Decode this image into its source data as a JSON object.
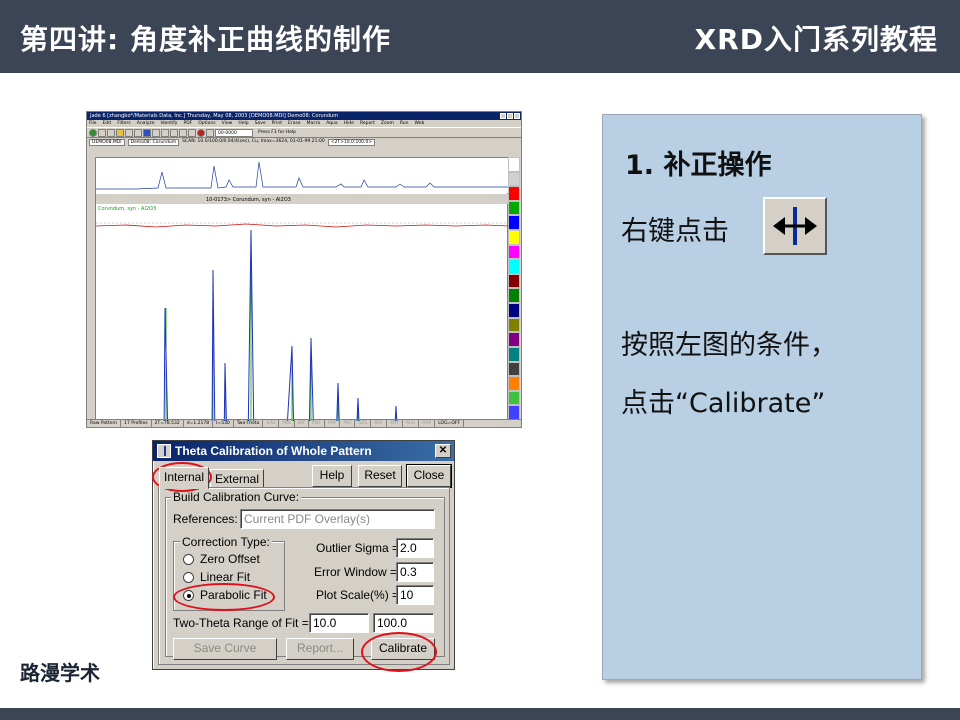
{
  "header": {
    "lecture_title": "第四讲: 角度补正曲线的制作",
    "series_title": "XRD入门系列教程"
  },
  "brand": "路漫学术",
  "jade_window": {
    "title": "Jade 6 [zhangbo*/Materials Data, Inc.] Thursday, May 08, 2003 [DEMO08.MDI] Demo08: Corundum",
    "menu": [
      "File",
      "Edit",
      "Filters",
      "Analyze",
      "Identify",
      "PDF",
      "Options",
      "View",
      "Help",
      "Save",
      "Print",
      "Erase",
      "Macro",
      "Aqua",
      "Hide",
      "Report",
      "Zoom",
      "Run",
      "Web"
    ],
    "combo_value": "00-0000",
    "help_hint": "Press F1 for Help",
    "file_combo": "DEMO08.MDI",
    "sample_name": "Demo08: Corundum",
    "scan_info": "SCAN: 10.0/100.0/0.04/4(sec), Cu, Imax=3624, 01-01-99 21:00",
    "range_info": "<2T>10.0:100.0>",
    "pdf_overlay": "10-0173> Corundum, syn - Al2O3",
    "legend_text": "Corundum, syn - Al2O3",
    "y_label_top": "Counts",
    "y_label_main": "Intensity(Counts)",
    "x_ticks": [
      "10",
      "20",
      "30",
      "40",
      "50",
      "60",
      "70",
      "80",
      "90",
      "100"
    ],
    "status": [
      "Raw Pattern",
      "17 Profiles",
      "2T=78.532",
      "d=1.2178",
      "I=530",
      "Two-Theta",
      "SAV",
      "PKS",
      "DIF",
      "PDF",
      "PRF",
      "PKT",
      "SZS",
      "XRF",
      "XRT",
      "ACH",
      "RRP",
      "LOG=OFF"
    ]
  },
  "dialog": {
    "title": "Theta Calibration of Whole Pattern",
    "tab_internal": "Internal",
    "tab_external": "External",
    "help_button": "Help",
    "reset_button": "Reset",
    "close_button": "Close",
    "build_group": "Build Calibration Curve:",
    "references_label": "References:",
    "references_value": "Current PDF Overlay(s)",
    "correction_group": "Correction Type:",
    "radio_zero": "Zero Offset",
    "radio_linear": "Linear Fit",
    "radio_parabolic": "Parabolic Fit",
    "outlier_label": "Outlier Sigma =",
    "outlier_value": "2.0",
    "error_label": "Error Window =",
    "error_value": "0.3",
    "plot_label": "Plot Scale(%) =",
    "plot_value": "10",
    "range_label": "Two-Theta Range of Fit =",
    "range_min": "10.0",
    "range_max": "100.0",
    "save_button": "Save Curve",
    "report_button": "Report...",
    "calibrate_button": "Calibrate"
  },
  "panel": {
    "heading": "1. 补正操作",
    "step1": "右键点击",
    "step2": "按照左图的条件，",
    "step3": "点击“Calibrate”"
  },
  "colors": {
    "header_bg": "#3c4555",
    "panel_bg": "#b8cfe4",
    "highlight": "#e0101a"
  }
}
